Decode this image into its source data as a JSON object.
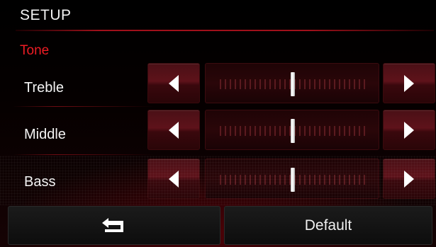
{
  "header": {
    "title": "SETUP"
  },
  "section": {
    "title": "Tone"
  },
  "colors": {
    "accent_red": "#ee1c24",
    "button_red": "#5e121a",
    "knob": "#ffffff"
  },
  "tone_rows": [
    {
      "label": "Treble",
      "decrease_icon": "arrow-left-icon",
      "increase_icon": "arrow-right-icon",
      "level": 0.5
    },
    {
      "label": "Middle",
      "decrease_icon": "arrow-left-icon",
      "increase_icon": "arrow-right-icon",
      "level": 0.5
    },
    {
      "label": "Bass",
      "decrease_icon": "arrow-left-icon",
      "increase_icon": "arrow-right-icon",
      "level": 0.5
    }
  ],
  "footer": {
    "back_icon": "back-arrow-icon",
    "default_label": "Default"
  }
}
